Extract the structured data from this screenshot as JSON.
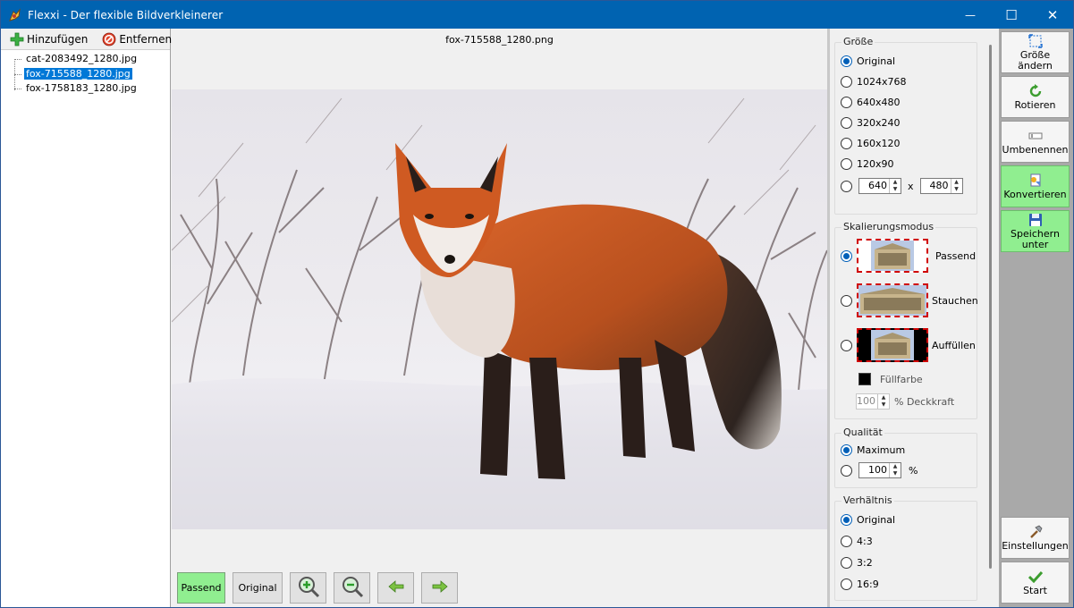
{
  "window": {
    "title": "Flexxi - Der flexible Bildverkleinerer",
    "icon": "flexxi-app-icon",
    "controls": {
      "minimize": "—",
      "maximize": "☐",
      "close": "✕"
    }
  },
  "left_toolbar": {
    "add_label": "Hinzufügen",
    "add_icon": "plus-icon",
    "remove_label": "Entfernen",
    "remove_icon": "remove-icon"
  },
  "files": [
    {
      "name": "cat-2083492_1280.jpg",
      "selected": false
    },
    {
      "name": "fox-715588_1280.jpg",
      "selected": true
    },
    {
      "name": "fox-1758183_1280.jpg",
      "selected": false
    }
  ],
  "preview": {
    "filename": "fox-715588_1280.png"
  },
  "bottom_toolbar": {
    "fit_label": "Passend",
    "original_label": "Original",
    "zoom_in_icon": "zoom-in-icon",
    "zoom_out_icon": "zoom-out-icon",
    "prev_icon": "arrow-left-icon",
    "next_icon": "arrow-right-icon"
  },
  "size_group": {
    "legend": "Größe",
    "options": [
      "Original",
      "1024x768",
      "640x480",
      "320x240",
      "160x120",
      "120x90"
    ],
    "selected": "Original",
    "custom_width": "640",
    "custom_height": "480",
    "custom_separator": "x"
  },
  "scale_group": {
    "legend": "Skalierungsmodus",
    "options": [
      "Passend",
      "Stauchen",
      "Auffüllen"
    ],
    "selected": "Passend",
    "fill_color_label": "Füllfarbe",
    "fill_color": "#000000",
    "opacity_value": "100",
    "opacity_label": "% Deckkraft"
  },
  "quality_group": {
    "legend": "Qualität",
    "max_label": "Maximum",
    "selected": "Maximum",
    "custom_value": "100",
    "unit": "%"
  },
  "ratio_group": {
    "legend": "Verhältnis",
    "options": [
      "Original",
      "4:3",
      "3:2",
      "16:9"
    ],
    "selected": "Original"
  },
  "sidebar": {
    "resize_label": "Größe ändern",
    "rotate_label": "Rotieren",
    "rename_label": "Umbenennen",
    "convert_label": "Konvertieren",
    "save_as_label": "Speichern unter",
    "settings_label": "Einstellungen",
    "start_label": "Start"
  },
  "colors": {
    "titlebar": "#0063b1",
    "selection": "#0078d7",
    "green_button": "#90ee90",
    "sidebar_bg": "#a9a9a9"
  }
}
